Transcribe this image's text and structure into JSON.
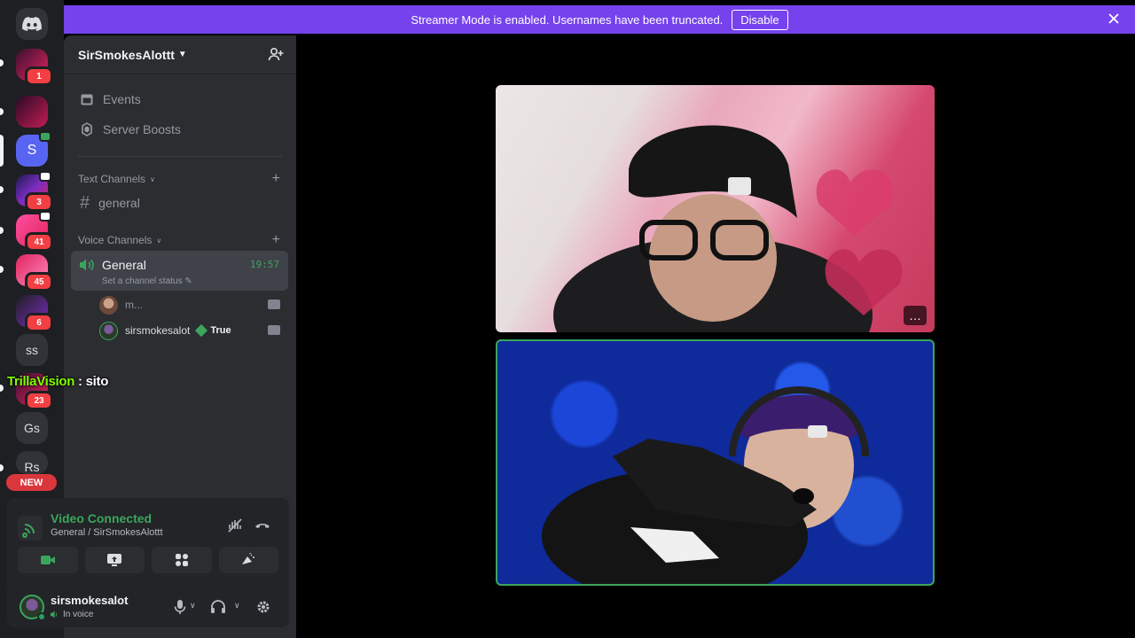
{
  "banner": {
    "message": "Streamer Mode is enabled. Usernames have been truncated.",
    "disable_label": "Disable"
  },
  "rail": {
    "servers": [
      {
        "label": "",
        "badge": "1"
      },
      {
        "label": "",
        "badge": ""
      },
      {
        "label": "S",
        "badge": ""
      },
      {
        "label": "",
        "badge": "3"
      },
      {
        "label": "",
        "badge": "41"
      },
      {
        "label": "",
        "badge": "45"
      },
      {
        "label": "",
        "badge": "6"
      },
      {
        "label": "ss",
        "badge": ""
      },
      {
        "label": "",
        "badge": "23"
      },
      {
        "label": "Gs",
        "badge": ""
      },
      {
        "label": "Rs",
        "badge": ""
      }
    ],
    "new_label": "NEW"
  },
  "sidebar": {
    "guild_name": "SirSmokesAlottt",
    "events_label": "Events",
    "boosts_label": "Server Boosts",
    "text_category": "Text Channels",
    "text_channels": [
      "general"
    ],
    "voice_category": "Voice Channels",
    "voice_channel": {
      "name": "General",
      "status": "Set a channel status",
      "elapsed": "19:57"
    },
    "voice_users": [
      {
        "name": "m...",
        "tag": ""
      },
      {
        "name": "sirsmokesalot",
        "tag": "True"
      }
    ]
  },
  "overlay_chat": {
    "username": "TrillaVision",
    "separator": " : ",
    "message": "sito"
  },
  "connection": {
    "status": "Video Connected",
    "location": "General / SirSmokesAlottt"
  },
  "user_panel": {
    "username": "sirsmokesalot",
    "status": "In voice"
  },
  "colors": {
    "banner": "#7642ed",
    "connected": "#3ba55d",
    "badge": "#f23f43",
    "rail": "#1e1f22",
    "sidebar": "#2b2d31"
  },
  "icons": [
    "discord-logo-icon",
    "calendar-icon",
    "boost-icon",
    "hash-icon",
    "speaker-icon",
    "camera-icon",
    "screen-share-icon",
    "activities-icon",
    "soundboard-icon",
    "mic-icon",
    "headphones-icon",
    "gear-icon",
    "disconnect-icon",
    "noise-suppression-icon",
    "invite-icon",
    "close-icon"
  ],
  "tile_more": "…"
}
